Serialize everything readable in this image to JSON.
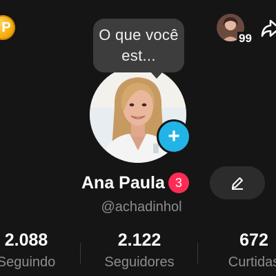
{
  "coin": {
    "letter": "P"
  },
  "friends": {
    "count": "99"
  },
  "note_bubble": {
    "text": "O que você est..."
  },
  "profile": {
    "name": "Ana Paula",
    "notification_count": "3",
    "username": "@achadinhol"
  },
  "stats": [
    {
      "value": "2.088",
      "label": "Seguindo"
    },
    {
      "value": "2.122",
      "label": "Seguidores"
    },
    {
      "value": "672",
      "label": "Curtidas"
    }
  ],
  "colors": {
    "background": "#151515",
    "accent_add": "#22b4e6",
    "badge": "#fe2c55",
    "coin": "#f0a400"
  },
  "icons": [
    "coin-icon",
    "share-icon",
    "plus-icon",
    "pencil-icon"
  ]
}
